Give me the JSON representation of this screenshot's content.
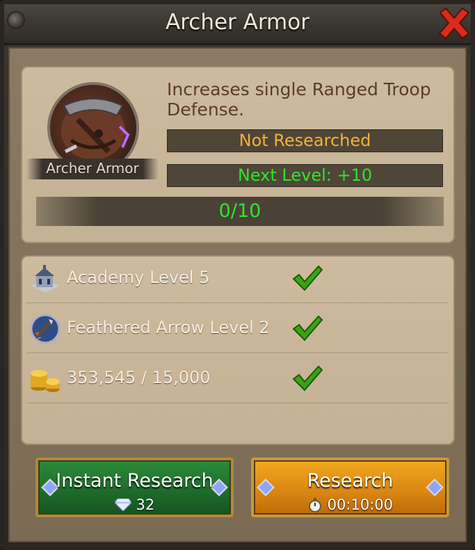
{
  "window": {
    "title": "Archer Armor",
    "close_icon": "close-x-icon",
    "accent_close": "#d92b1c"
  },
  "tech": {
    "portrait_label": "Archer Armor",
    "description": "Increases single Ranged Troop Defense.",
    "status": "Not Researched",
    "next_level": "Next Level: +10",
    "progress": "0/10",
    "progress_fraction": 0,
    "status_color": "#f2b13a",
    "green_color": "#2ee62e"
  },
  "requirements": [
    {
      "icon": "academy-building-icon",
      "text": "Academy Level 5",
      "met": true
    },
    {
      "icon": "feathered-arrow-icon",
      "text": "Feathered Arrow Level 2",
      "met": true
    },
    {
      "icon": "gold-coins-icon",
      "text": "353,545 / 15,000",
      "met": true
    }
  ],
  "buttons": {
    "instant": {
      "label": "Instant Research",
      "cost_icon": "diamond-icon",
      "cost": "32"
    },
    "research": {
      "label": "Research",
      "time_icon": "stopwatch-icon",
      "time": "00:10:00"
    }
  }
}
